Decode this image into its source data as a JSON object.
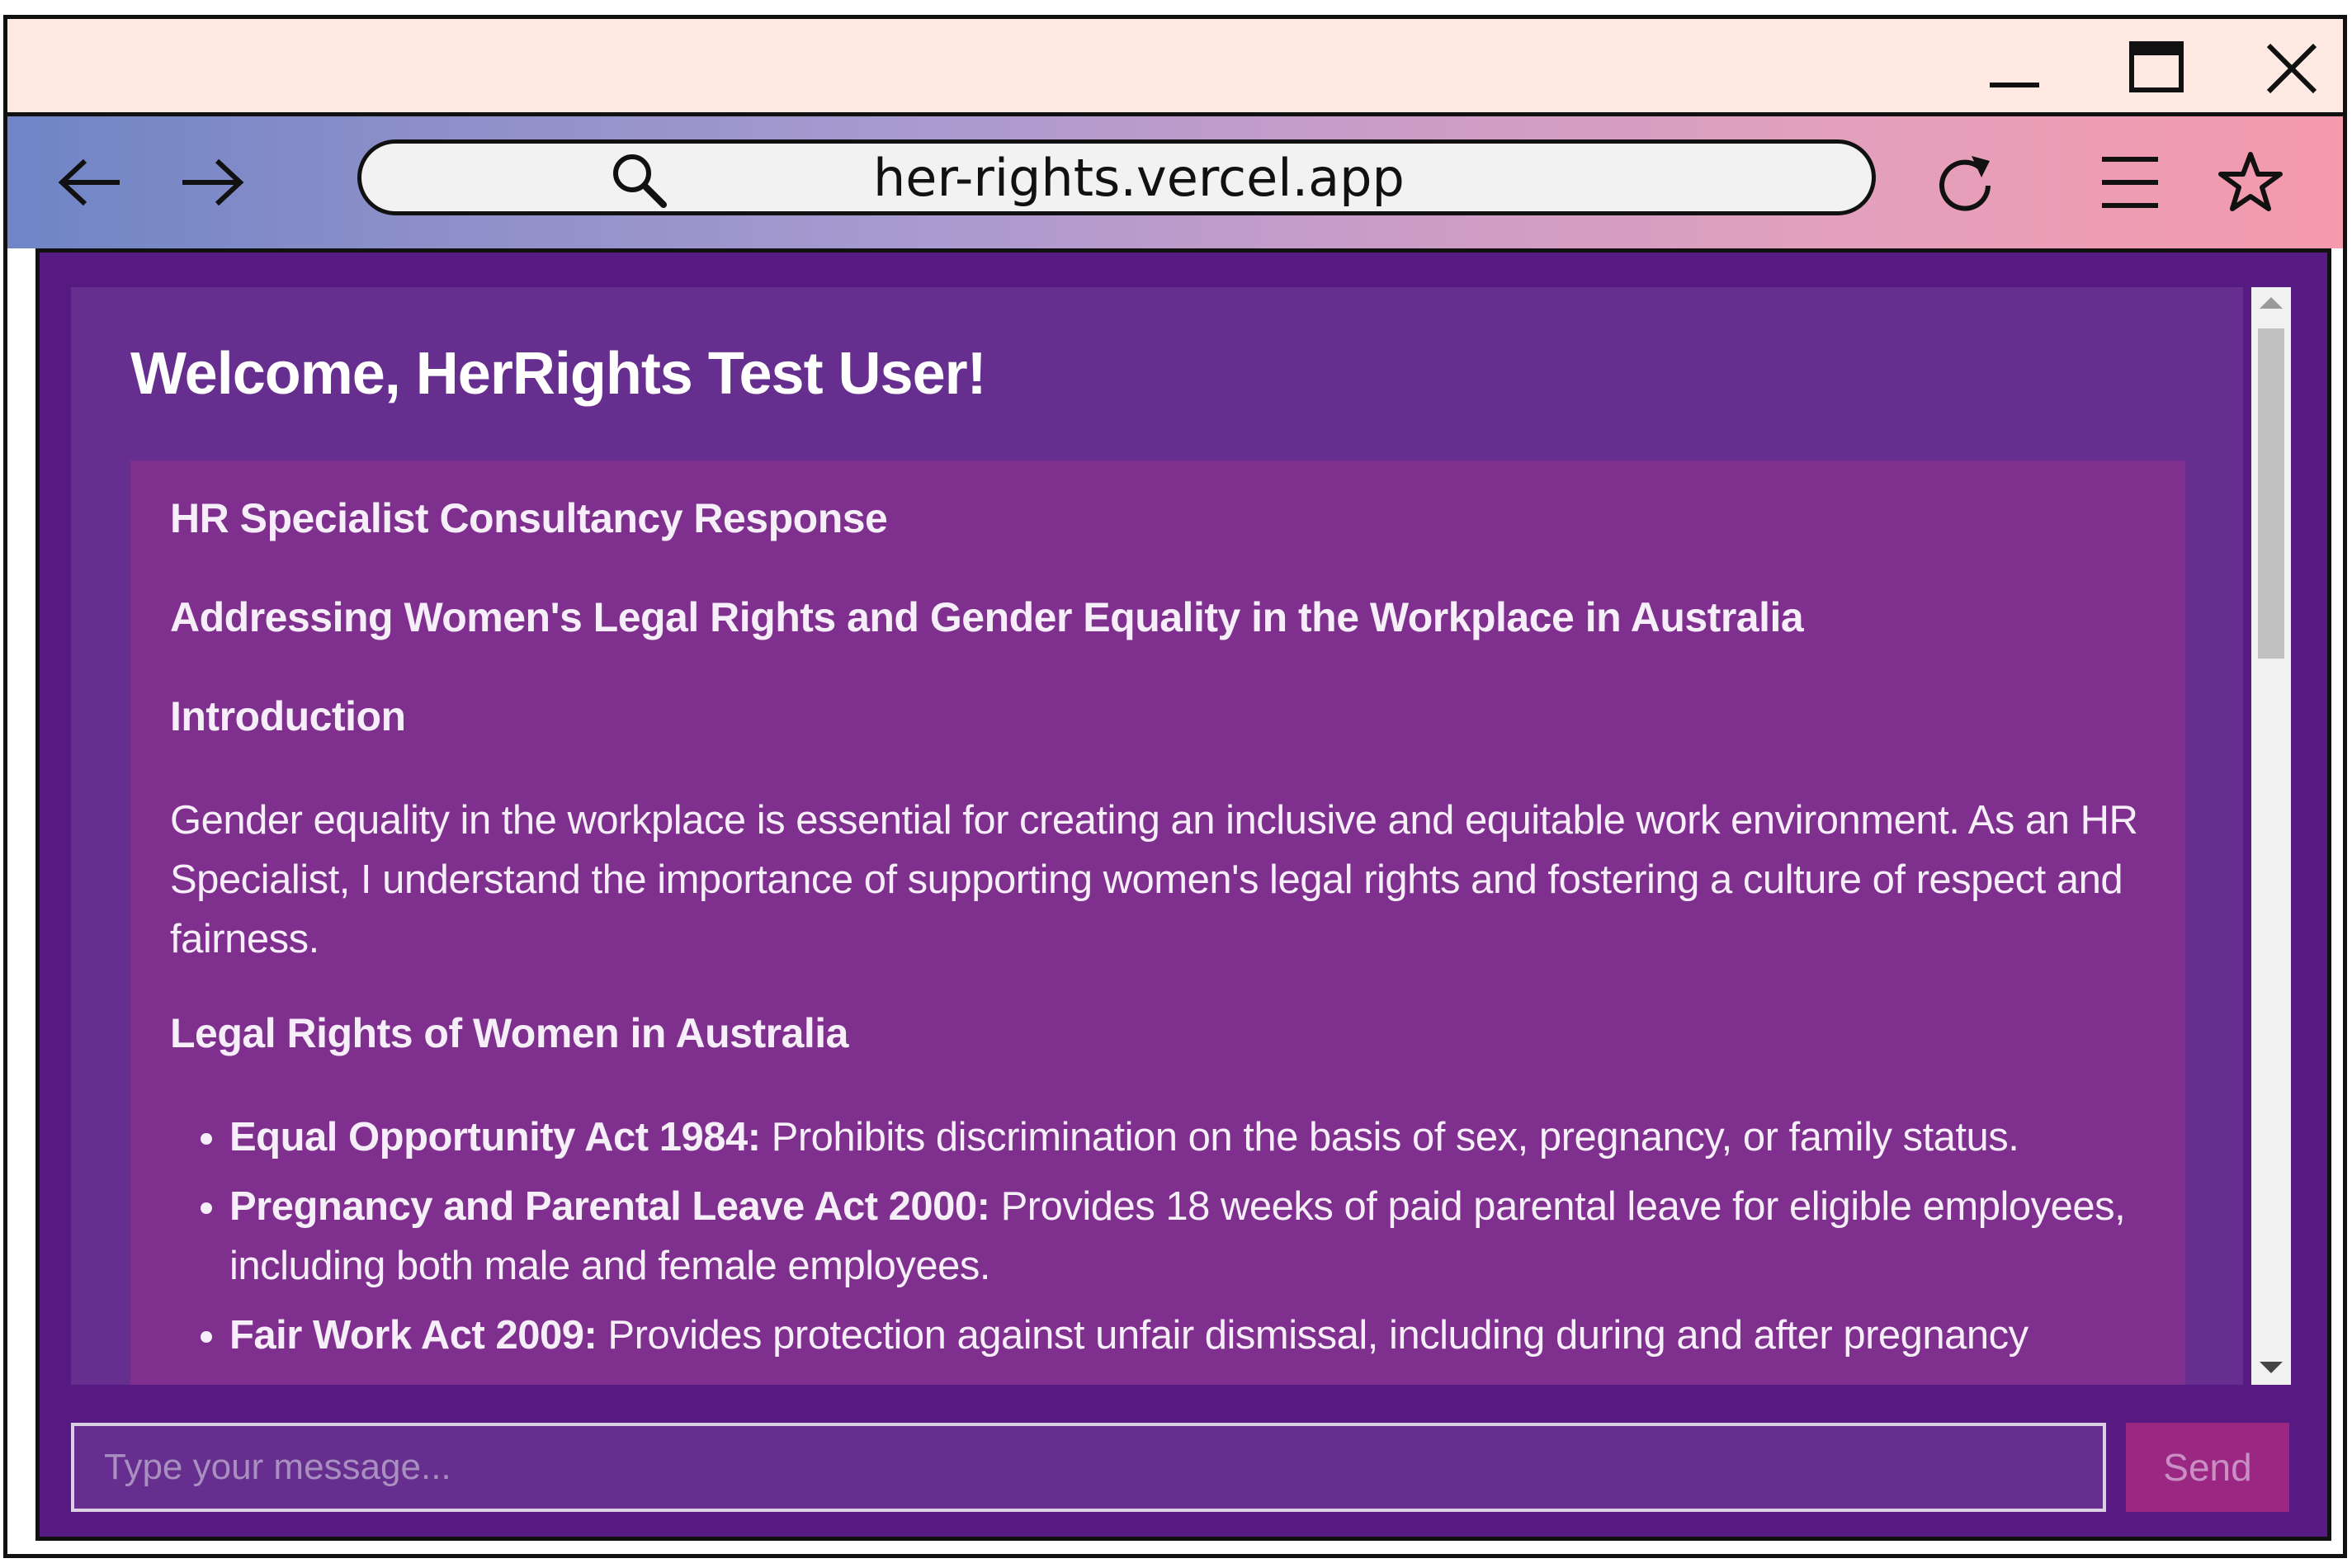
{
  "browser": {
    "url": "her-rights.vercel.app"
  },
  "page": {
    "welcome": "Welcome, HerRights Test User!",
    "response": {
      "heading1": "HR Specialist Consultancy Response",
      "heading2": "Addressing Women's Legal Rights and Gender Equality in the Workplace in Australia",
      "heading3": "Introduction",
      "intro": "Gender equality in the workplace is essential for creating an inclusive and equitable work environment. As an HR Specialist, I understand the importance of supporting women's legal rights and fostering a culture of respect and fairness.",
      "heading4": "Legal Rights of Women in Australia",
      "laws": [
        {
          "name": "Equal Opportunity Act 1984:",
          "desc": " Prohibits discrimination on the basis of sex, pregnancy, or family status."
        },
        {
          "name": "Pregnancy and Parental Leave Act 2000:",
          "desc": " Provides 18 weeks of paid parental leave for eligible employees, including both male and female employees."
        },
        {
          "name": "Fair Work Act 2009:",
          "desc": " Provides protection against unfair dismissal, including during and after pregnancy"
        }
      ]
    },
    "input_placeholder": "Type your message...",
    "send_label": "Send"
  },
  "icons": {
    "minimize": "minimize-icon",
    "maximize": "maximize-icon",
    "close": "close-icon",
    "back": "arrow-left-icon",
    "forward": "arrow-right-icon",
    "search": "search-icon",
    "reload": "reload-icon",
    "menu": "menu-icon",
    "bookmark": "star-icon"
  },
  "colors": {
    "titlebar": "#feeae2",
    "viewport": "#561a82",
    "panel": "#662e8e",
    "card": "#7f2f8e",
    "send_button": "#9a2882"
  }
}
